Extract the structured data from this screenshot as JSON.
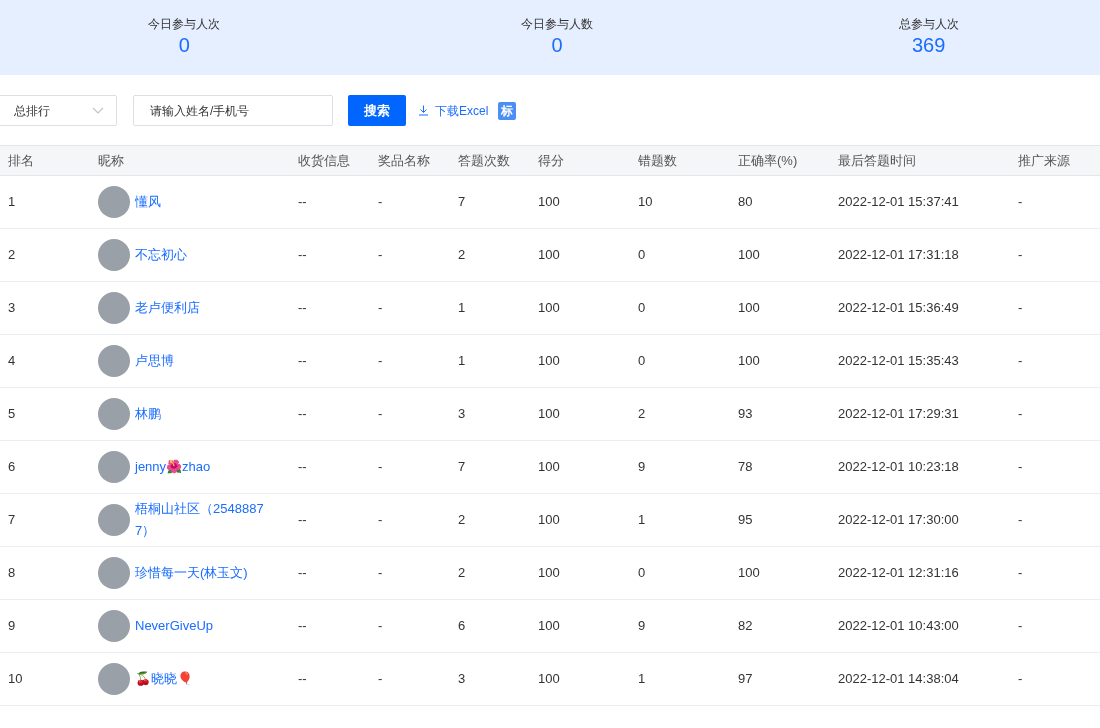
{
  "stats": [
    {
      "label": "今日参与人次",
      "value": "0"
    },
    {
      "label": "今日参与人数",
      "value": "0"
    },
    {
      "label": "总参与人次",
      "value": "369"
    }
  ],
  "toolbar": {
    "select": "总排行",
    "search_placeholder": "请输入姓名/手机号",
    "search_button": "搜索",
    "download_link": "下载Excel",
    "badge": "标"
  },
  "table": {
    "columns": [
      "排名",
      "昵称",
      "收货信息",
      "奖品名称",
      "答题次数",
      "得分",
      "错题数",
      "正确率(%)",
      "最后答题时间",
      "推广来源"
    ],
    "rows": [
      {
        "rank": "1",
        "nickname": "懂风",
        "shipping": "--",
        "prize": "-",
        "attempts": "7",
        "score": "100",
        "wrong": "10",
        "accuracy": "80",
        "last_time": "2022-12-01 15:37:41",
        "source": "-"
      },
      {
        "rank": "2",
        "nickname": "不忘初心",
        "shipping": "--",
        "prize": "-",
        "attempts": "2",
        "score": "100",
        "wrong": "0",
        "accuracy": "100",
        "last_time": "2022-12-01 17:31:18",
        "source": "-"
      },
      {
        "rank": "3",
        "nickname": "老卢便利店",
        "shipping": "--",
        "prize": "-",
        "attempts": "1",
        "score": "100",
        "wrong": "0",
        "accuracy": "100",
        "last_time": "2022-12-01 15:36:49",
        "source": "-"
      },
      {
        "rank": "4",
        "nickname": "卢思博",
        "shipping": "--",
        "prize": "-",
        "attempts": "1",
        "score": "100",
        "wrong": "0",
        "accuracy": "100",
        "last_time": "2022-12-01 15:35:43",
        "source": "-"
      },
      {
        "rank": "5",
        "nickname": "林鹏",
        "shipping": "--",
        "prize": "-",
        "attempts": "3",
        "score": "100",
        "wrong": "2",
        "accuracy": "93",
        "last_time": "2022-12-01 17:29:31",
        "source": "-"
      },
      {
        "rank": "6",
        "nickname": "jenny🌺zhao",
        "shipping": "--",
        "prize": "-",
        "attempts": "7",
        "score": "100",
        "wrong": "9",
        "accuracy": "78",
        "last_time": "2022-12-01 10:23:18",
        "source": "-"
      },
      {
        "rank": "7",
        "nickname": "梧桐山社区（25488877）",
        "shipping": "--",
        "prize": "-",
        "attempts": "2",
        "score": "100",
        "wrong": "1",
        "accuracy": "95",
        "last_time": "2022-12-01 17:30:00",
        "source": "-"
      },
      {
        "rank": "8",
        "nickname": "珍惜每一天(林玉文)",
        "shipping": "--",
        "prize": "-",
        "attempts": "2",
        "score": "100",
        "wrong": "0",
        "accuracy": "100",
        "last_time": "2022-12-01 12:31:16",
        "source": "-"
      },
      {
        "rank": "9",
        "nickname": "NeverGiveUp",
        "shipping": "--",
        "prize": "-",
        "attempts": "6",
        "score": "100",
        "wrong": "9",
        "accuracy": "82",
        "last_time": "2022-12-01 10:43:00",
        "source": "-"
      },
      {
        "rank": "10",
        "nickname": "🍒晓晓🎈",
        "shipping": "--",
        "prize": "-",
        "attempts": "3",
        "score": "100",
        "wrong": "1",
        "accuracy": "97",
        "last_time": "2022-12-01 14:38:04",
        "source": "-"
      }
    ]
  }
}
